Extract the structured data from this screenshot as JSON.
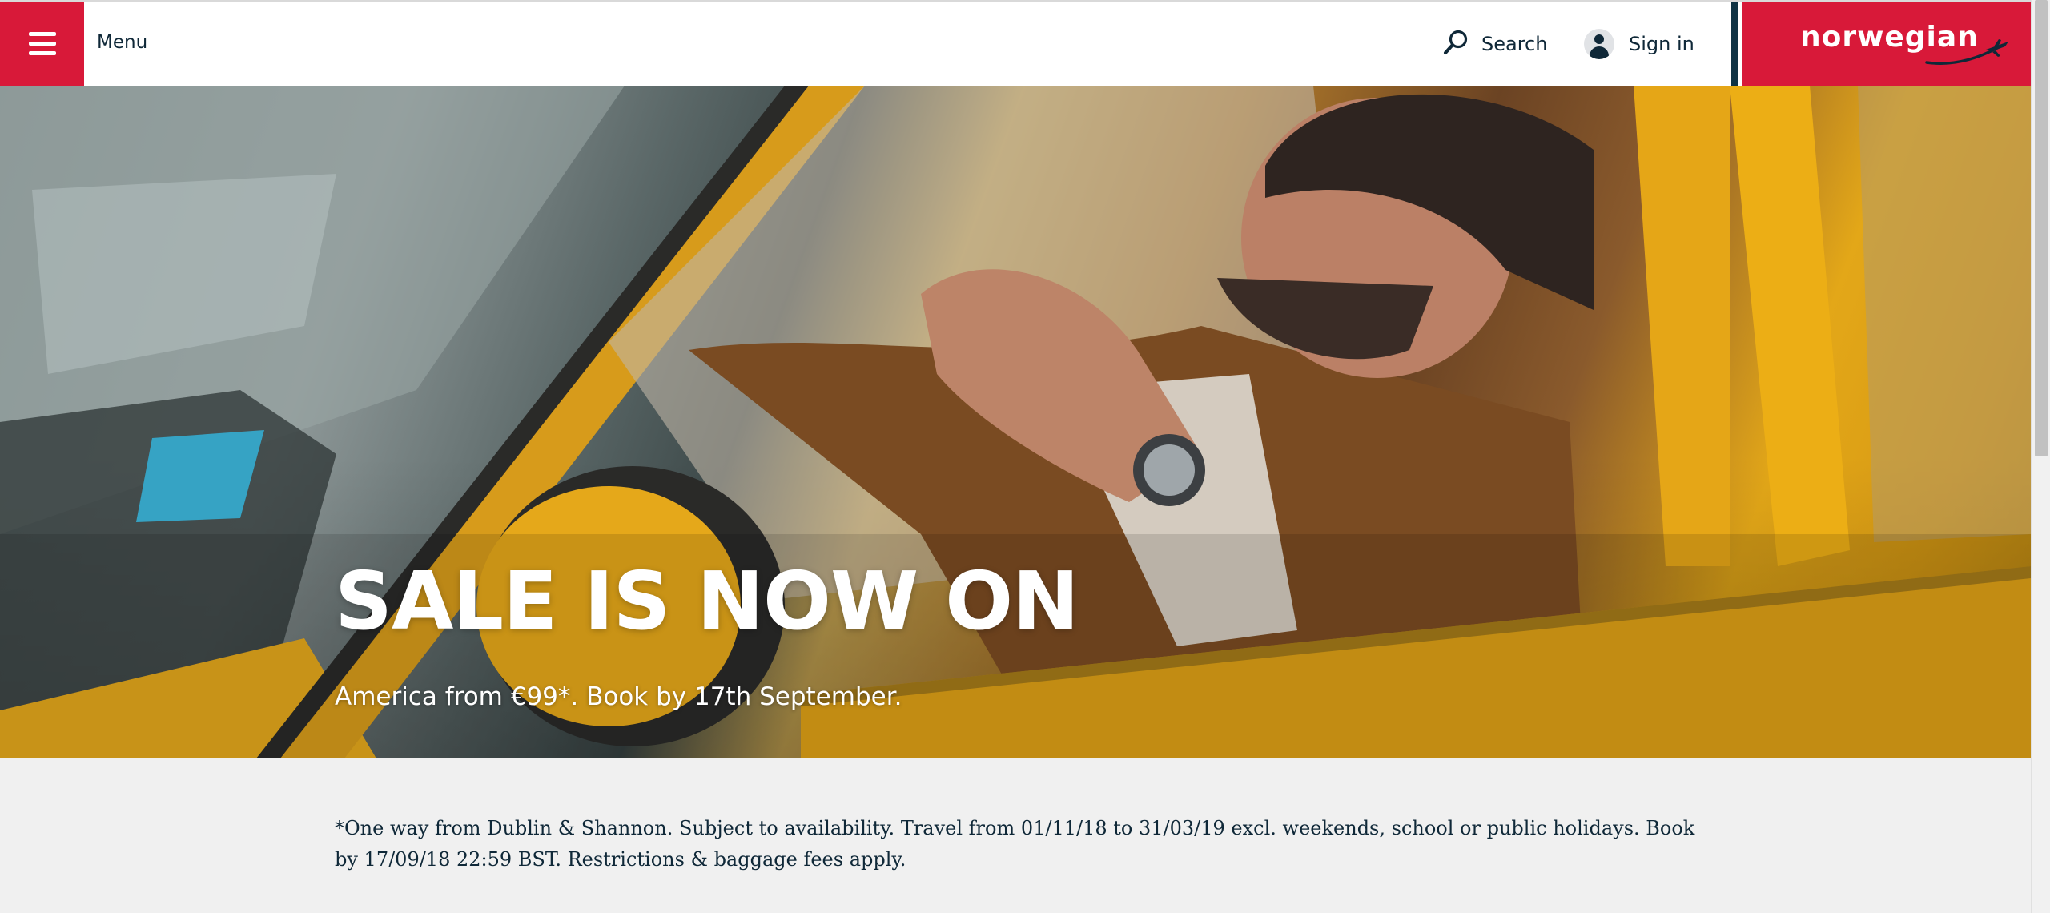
{
  "header": {
    "menu_label": "Menu",
    "search_label": "Search",
    "signin_label": "Sign in",
    "logo_text": "norwegian"
  },
  "hero": {
    "title": "SALE IS NOW ON",
    "subtitle": "America from €99*. Book by 17th September."
  },
  "footnote": {
    "text": "*One way from Dublin & Shannon. Subject to availability. Travel from 01/11/18 to 31/03/19 excl. weekends, school or public holidays. Book by 17/09/18 22:59 BST. Restrictions & baggage fees apply."
  },
  "colors": {
    "brand_red": "#d81939",
    "navy_text": "#0f2838",
    "footnote_bg": "#f0f0f0"
  },
  "icons": {
    "menu": "hamburger-icon",
    "search": "search-icon",
    "signin": "user-avatar-icon",
    "logo": "airplane-icon"
  }
}
